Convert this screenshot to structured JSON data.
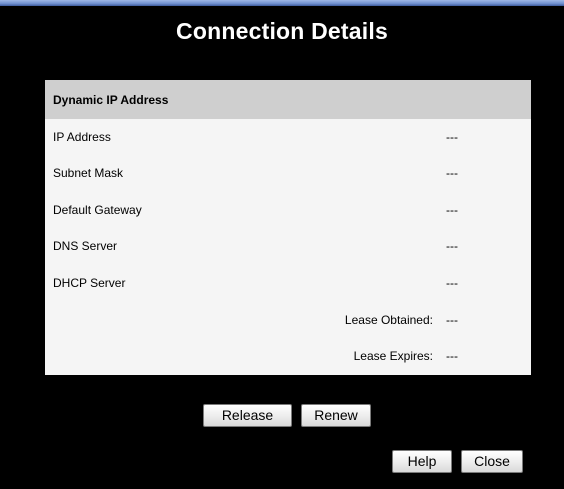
{
  "title": "Connection Details",
  "section": {
    "header": "Dynamic IP Address",
    "rows": [
      {
        "label": "IP Address",
        "value": "---"
      },
      {
        "label": "Subnet Mask",
        "value": "---"
      },
      {
        "label": "Default Gateway",
        "value": "---"
      },
      {
        "label": "DNS Server",
        "value": "---"
      },
      {
        "label": "DHCP Server",
        "value": "---"
      },
      {
        "label": "Lease Obtained:",
        "value": "---"
      },
      {
        "label": "Lease Expires:",
        "value": "---"
      }
    ]
  },
  "buttons": {
    "release": "Release",
    "renew": "Renew",
    "help": "Help",
    "close": "Close"
  }
}
